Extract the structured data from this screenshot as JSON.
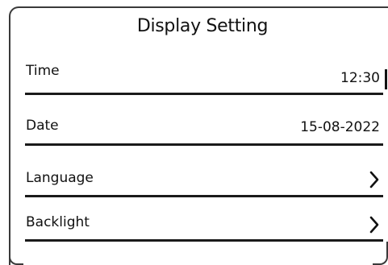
{
  "screen": {
    "title": "Display Setting"
  },
  "rows": [
    {
      "label": "Time",
      "value": "12:30"
    },
    {
      "label": "Date",
      "value": "15-08-2022"
    },
    {
      "label": "Language",
      "icon": "chevron-right-icon"
    },
    {
      "label": "Backlight",
      "icon": "chevron-right-icon"
    }
  ]
}
